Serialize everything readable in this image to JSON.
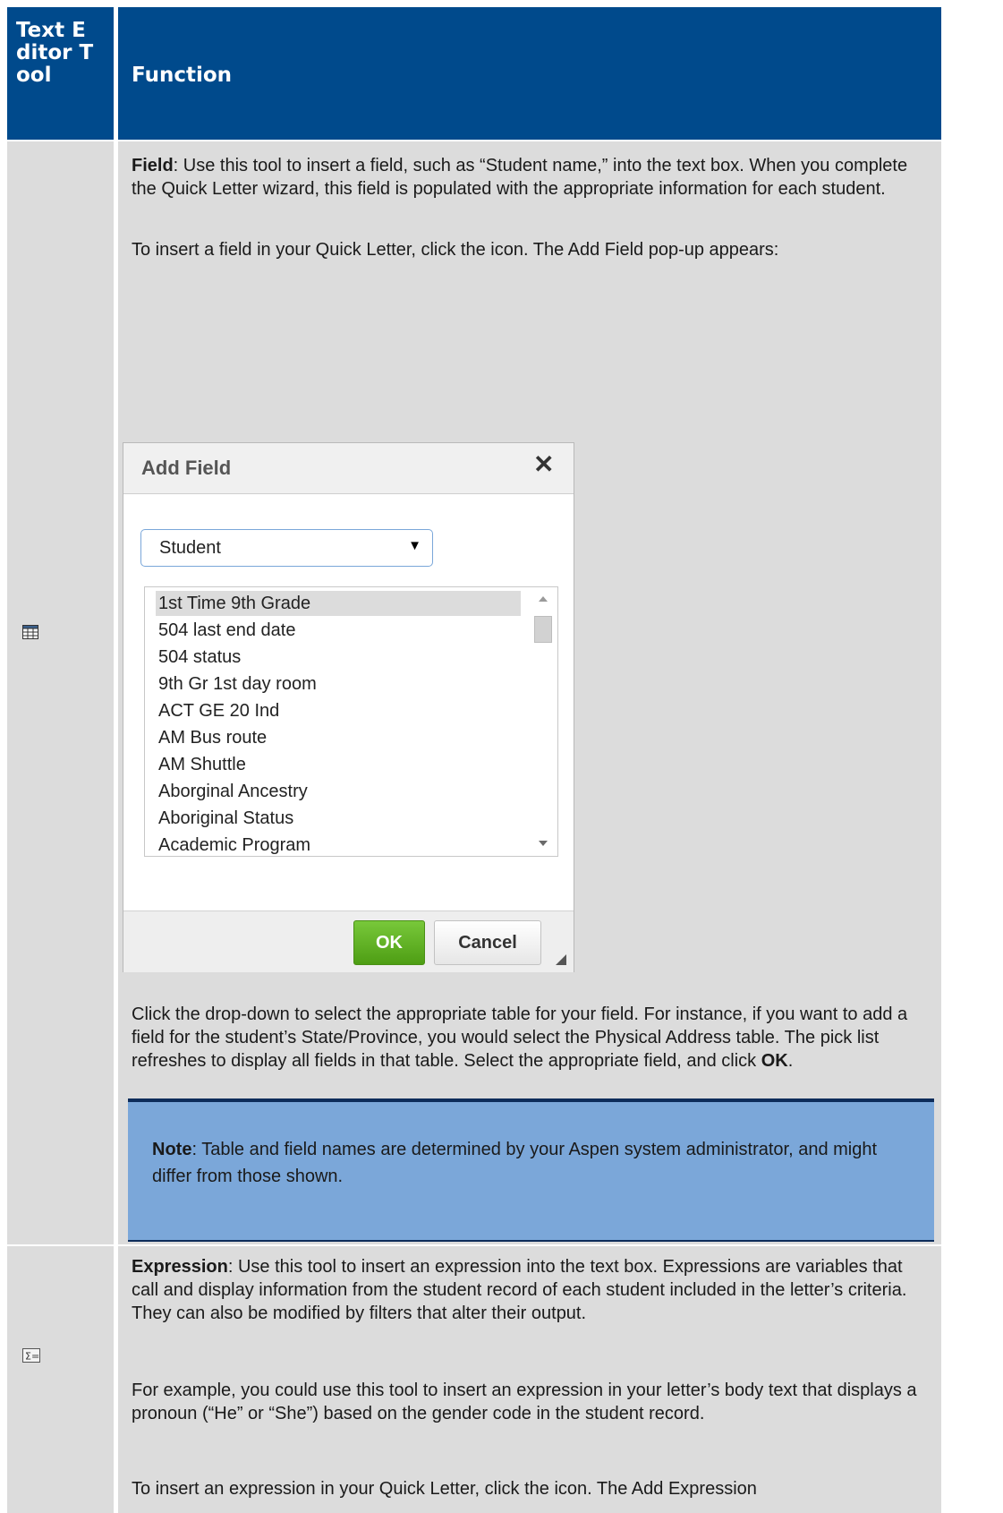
{
  "header": {
    "tool_col": "Text Editor Tool",
    "function_col": "Function"
  },
  "row_field": {
    "icon": "table-grid-icon",
    "para1_bold": "Field",
    "para1_rest": ": Use this tool to insert a field, such as “Student name,” into the text box. When you complete the Quick Letter wizard, this field is populated with the appropriate information for each student.",
    "para2": "To insert a field in your Quick Letter, click the icon. The Add Field pop-up appears:",
    "dialog": {
      "title": "Add Field",
      "close_glyph": "✕",
      "table_select_value": "Student",
      "fields": [
        "1st Time 9th Grade",
        "504 last end date",
        "504 status",
        "9th Gr 1st day room",
        "ACT GE 20 Ind",
        "AM Bus route",
        "AM Shuttle",
        "Aborginal Ancestry",
        "Aboriginal Status",
        "Academic Program"
      ],
      "selected_field": "1st Time 9th Grade",
      "ok_label": "OK",
      "cancel_label": "Cancel"
    },
    "para3_pre": "Click the drop-down to select the appropriate table for your field. For instance, if you want to add a field for the student’s State/Province, you would select the Physical Address table. The pick list refreshes to display all fields in that table. Select the appropriate field, and click ",
    "para3_bold": "OK",
    "para3_post": ".",
    "note_bold": "Note",
    "note_rest": ": Table and field names are determined by your Aspen system administrator, and might differ from those shown."
  },
  "row_expression": {
    "icon": "sigma-expression-icon",
    "para1_bold": "Expression",
    "para1_rest": ": Use this tool to insert an expression into the text box. Expressions are variables that call and display information from the student record of each student included in the letter’s criteria. They can also be modified by filters that alter their output.",
    "para2": "For example, you could use this tool to insert an expression in your letter’s body text that displays a pronoun (“He” or “She”) based on the gender code in the student record.",
    "para3": "To insert an expression in your Quick Letter, click the icon. The Add Expression"
  },
  "colors": {
    "header_bg": "#004a8c",
    "row_bg": "#dcdcdc",
    "note_bg": "#7ba7d9",
    "ok_green": "#5aae1e"
  }
}
